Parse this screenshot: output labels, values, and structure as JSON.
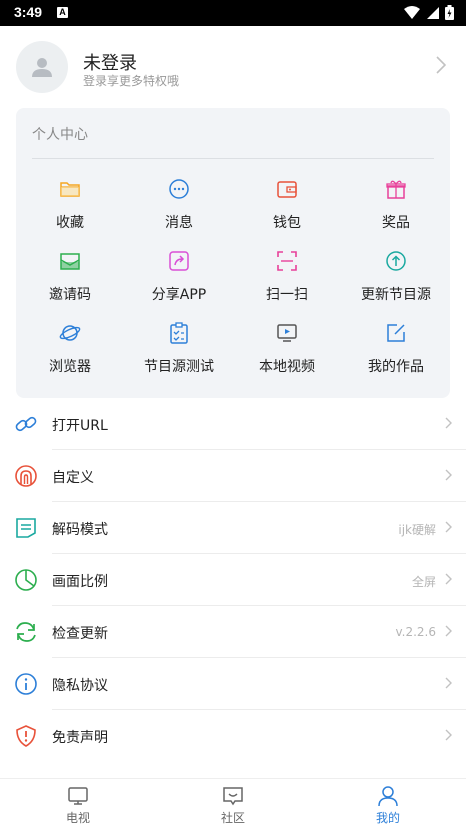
{
  "status_bar": {
    "time": "3:49",
    "badge": "A"
  },
  "profile": {
    "name": "未登录",
    "subtitle": "登录享更多特权哦"
  },
  "personal_center": {
    "title": "个人中心",
    "items": [
      {
        "label": "收藏",
        "icon": "folder-icon",
        "color": "#f5a623"
      },
      {
        "label": "消息",
        "icon": "chat-bubble-icon",
        "color": "#2d7fd8"
      },
      {
        "label": "钱包",
        "icon": "wallet-icon",
        "color": "#e8523a"
      },
      {
        "label": "奖品",
        "icon": "gift-icon",
        "color": "#e8409a"
      },
      {
        "label": "邀请码",
        "icon": "invite-envelope-icon",
        "color": "#2cae4e"
      },
      {
        "label": "分享APP",
        "icon": "share-icon",
        "color": "#d94fd6"
      },
      {
        "label": "扫一扫",
        "icon": "scan-icon",
        "color": "#e8409a"
      },
      {
        "label": "更新节目源",
        "icon": "upload-circle-icon",
        "color": "#1aa9a0"
      },
      {
        "label": "浏览器",
        "icon": "planet-icon",
        "color": "#2d7fd8"
      },
      {
        "label": "节目源测试",
        "icon": "clipboard-check-icon",
        "color": "#2d7fd8"
      },
      {
        "label": "本地视频",
        "icon": "video-screen-icon",
        "color": "#555555"
      },
      {
        "label": "我的作品",
        "icon": "edit-square-icon",
        "color": "#2d7fd8"
      }
    ]
  },
  "settings": [
    {
      "label": "打开URL",
      "value": "",
      "icon": "link-icon",
      "color": "#2d7fd8"
    },
    {
      "label": "自定义",
      "value": "",
      "icon": "custom-arch-icon",
      "color": "#e8523a"
    },
    {
      "label": "解码模式",
      "value": "ijk硬解",
      "icon": "decode-doc-icon",
      "color": "#1aa9a0"
    },
    {
      "label": "画面比例",
      "value": "全屏",
      "icon": "pie-chart-icon",
      "color": "#2cae4e"
    },
    {
      "label": "检查更新",
      "value": "v.2.2.6",
      "icon": "refresh-icon",
      "color": "#2cae4e"
    },
    {
      "label": "隐私协议",
      "value": "",
      "icon": "privacy-info-icon",
      "color": "#2d7fd8"
    },
    {
      "label": "免责声明",
      "value": "",
      "icon": "shield-warning-icon",
      "color": "#e8523a"
    }
  ],
  "tabs": [
    {
      "label": "电视",
      "icon": "tv-icon"
    },
    {
      "label": "社区",
      "icon": "community-chat-icon"
    },
    {
      "label": "我的",
      "icon": "person-icon"
    }
  ],
  "accent_color": "#2d7fd8"
}
